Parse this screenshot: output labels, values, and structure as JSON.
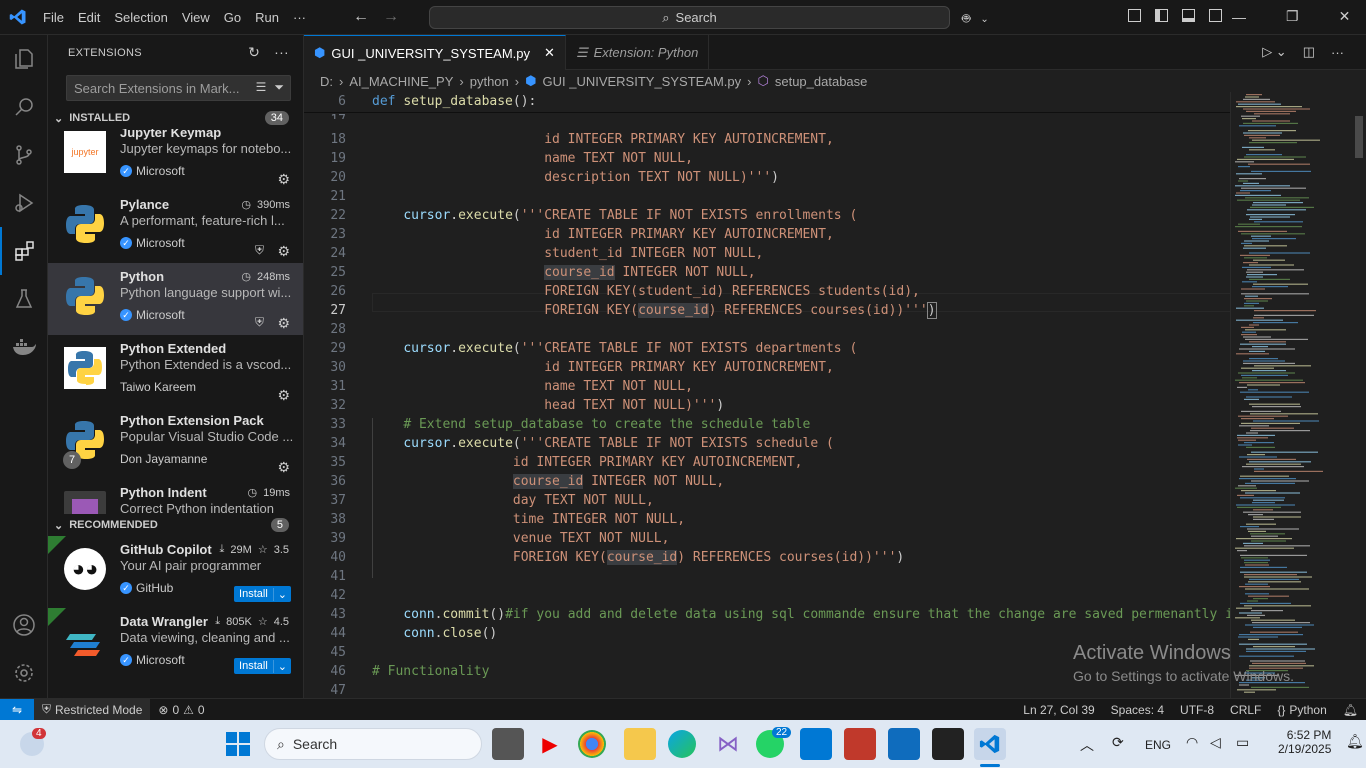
{
  "menu": [
    "File",
    "Edit",
    "Selection",
    "View",
    "Go",
    "Run",
    "···"
  ],
  "search_label": "Search",
  "sidebar": {
    "title": "EXTENSIONS",
    "search_placeholder": "Search Extensions in Mark...",
    "installed_label": "INSTALLED",
    "installed_count": "34",
    "recommended_label": "RECOMMENDED",
    "recommended_count": "5",
    "installed": [
      {
        "name": "Jupyter Keymap",
        "desc": "Jupyter keymaps for notebo...",
        "pub": "Microsoft",
        "meta": ""
      },
      {
        "name": "Pylance",
        "desc": "A performant, feature-rich l...",
        "pub": "Microsoft",
        "meta": "390ms"
      },
      {
        "name": "Python",
        "desc": "Python language support wi...",
        "pub": "Microsoft",
        "meta": "248ms"
      },
      {
        "name": "Python Extended",
        "desc": "Python Extended is a vscod...",
        "pub": "Taiwo Kareem",
        "meta": ""
      },
      {
        "name": "Python Extension Pack",
        "desc": "Popular Visual Studio Code ...",
        "pub": "Don Jayamanne",
        "meta": ""
      },
      {
        "name": "Python Indent",
        "desc": "Correct Python indentation",
        "pub": "",
        "meta": "19ms"
      }
    ],
    "extpack_badge": "7",
    "recommended": [
      {
        "name": "GitHub Copilot",
        "desc": "Your AI pair programmer",
        "pub": "GitHub",
        "downloads": "29M",
        "rating": "3.5",
        "install": "Install"
      },
      {
        "name": "Data Wrangler",
        "desc": "Data viewing, cleaning and ...",
        "pub": "Microsoft",
        "downloads": "805K",
        "rating": "4.5",
        "install": "Install"
      }
    ]
  },
  "tabs": [
    {
      "label": "GUI _UNIVERSITY_SYSTEAM.py",
      "active": true
    },
    {
      "label": "Extension: Python",
      "active": false
    }
  ],
  "breadcrumb": [
    "D:",
    "AI_MACHINE_PY",
    "python",
    "GUI _UNIVERSITY_SYSTEAM.py",
    "setup_database"
  ],
  "editor": {
    "sticky_line_num": "6",
    "cursor_line": "27"
  },
  "status": {
    "mode": "Restricted Mode",
    "errors": "0",
    "warnings": "0",
    "position": "Ln 27, Col 39",
    "spaces": "Spaces: 4",
    "encoding": "UTF-8",
    "eol": "CRLF",
    "language": "Python"
  },
  "watermark": {
    "line1": "Activate Windows",
    "line2": "Go to Settings to activate Windows."
  },
  "taskbar": {
    "search": "Search",
    "weather_badge": "4",
    "whatsapp_badge": "22",
    "lang": "ENG",
    "time": "6:52 PM",
    "date": "2/19/2025"
  },
  "colors": {
    "accent": "#0078d4",
    "bg": "#1f1f1f",
    "keyword": "#569cd6",
    "string": "#ce9178",
    "comment": "#6a9955",
    "function": "#dcdcaa"
  }
}
